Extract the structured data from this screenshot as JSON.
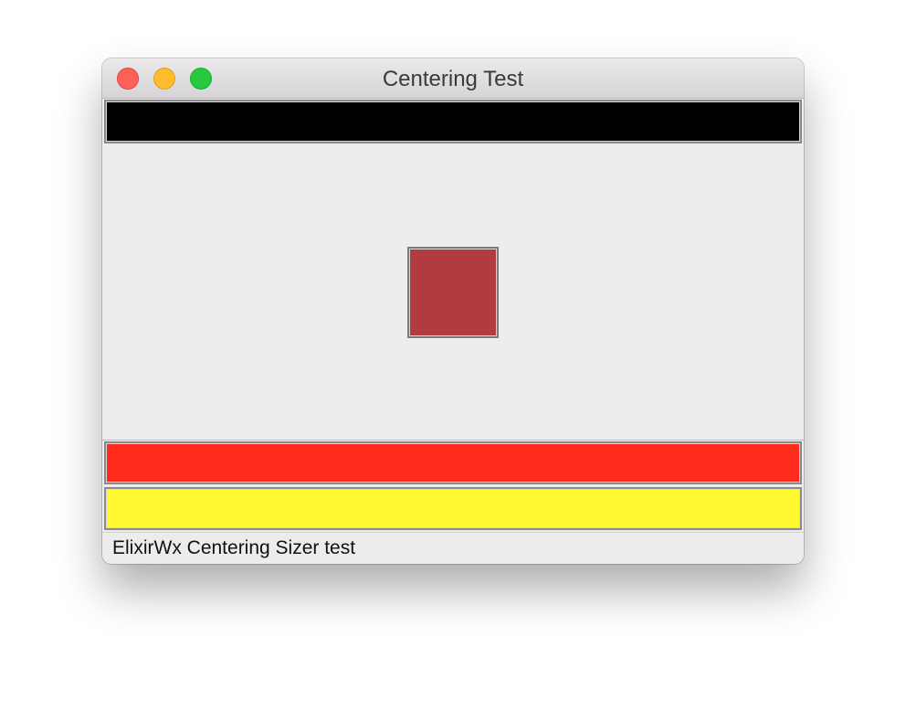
{
  "window": {
    "title": "Centering Test",
    "traffic_lights": [
      {
        "name": "close",
        "color": "#fe5f57"
      },
      {
        "name": "minimize",
        "color": "#febb2e"
      },
      {
        "name": "zoom",
        "color": "#28c840"
      }
    ]
  },
  "panels": {
    "top_color": "#000000",
    "center_square_color": "#b03c3e",
    "bottom_red_color": "#ff2b1c",
    "bottom_yellow_color": "#fff82e"
  },
  "statusbar": {
    "text": "ElixirWx Centering Sizer test"
  }
}
